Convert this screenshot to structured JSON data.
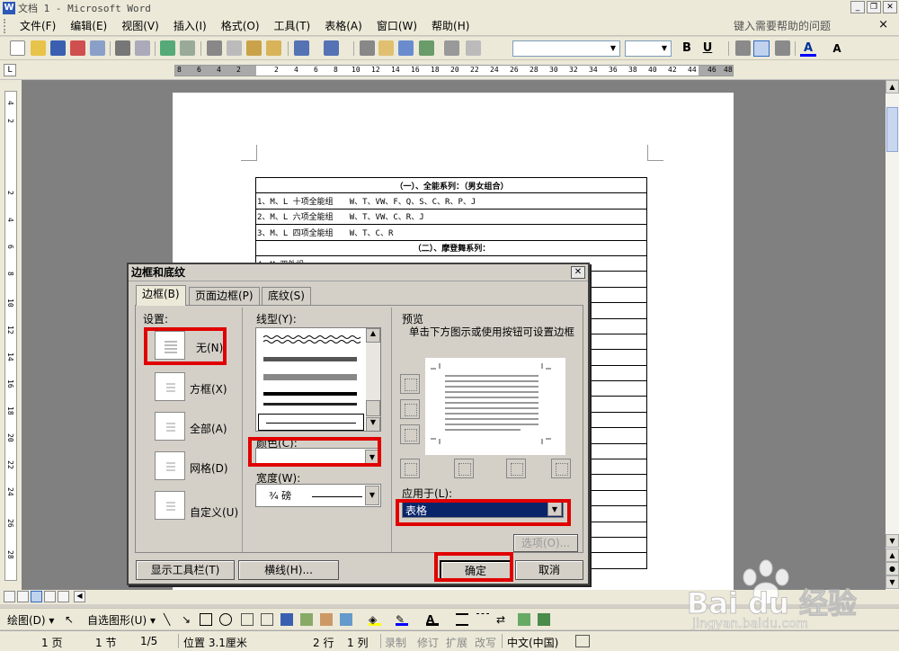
{
  "window": {
    "title": "文档 1 - Microsoft Word",
    "app_icon": "W",
    "buttons": [
      "_",
      "❐",
      "✕"
    ]
  },
  "menu": {
    "items": [
      "文件(F)",
      "编辑(E)",
      "视图(V)",
      "插入(I)",
      "格式(O)",
      "工具(T)",
      "表格(A)",
      "窗口(W)",
      "帮助(H)"
    ],
    "help_placeholder": "键入需要帮助的问题",
    "close": "×"
  },
  "toolbar": {
    "bold": "B",
    "underline": "U",
    "font_color_glyph": "A",
    "grow_font": "A"
  },
  "ruler": {
    "corner": "L",
    "h_ticks": [
      "8",
      "6",
      "4",
      "2",
      "2",
      "4",
      "6",
      "8",
      "10",
      "12",
      "14",
      "16",
      "18",
      "20",
      "22",
      "24",
      "26",
      "28",
      "30",
      "32",
      "34",
      "36",
      "38",
      "40",
      "42",
      "44",
      "46",
      "48"
    ],
    "v_ticks": [
      "4",
      "2",
      "2",
      "4",
      "6",
      "8",
      "10",
      "12",
      "14",
      "16",
      "18",
      "20",
      "22",
      "24",
      "26",
      "28"
    ]
  },
  "document": {
    "rows": [
      {
        "header": true,
        "text": "（一）、全能系列：（男女组合）"
      },
      {
        "header": false,
        "name": "1、M、L 十项全能组",
        "value": "W、T、VW、F、Q、S、C、R、P、J"
      },
      {
        "header": false,
        "name": "2、M、L 六项全能组",
        "value": "W、T、VW、C、R、J"
      },
      {
        "header": false,
        "name": "3、M、L 四项全能组",
        "value": "W、T、C、R"
      },
      {
        "header": true,
        "text": "（二）、摩登舞系列："
      }
    ],
    "hidden_row": "4、M 双外组"
  },
  "dialog": {
    "title": "边框和底纹",
    "tabs": [
      "边框(B)",
      "页面边框(P)",
      "底纹(S)"
    ],
    "setting_label": "设置:",
    "settings": [
      "无(N)",
      "方框(X)",
      "全部(A)",
      "网格(D)",
      "自定义(U)"
    ],
    "style_label": "线型(Y):",
    "color_label": "颜色(C):",
    "color_value": "",
    "width_label": "宽度(W):",
    "width_value": "¾ 磅",
    "preview_label": "预览",
    "preview_hint": "单击下方图示或使用按钮可设置边框",
    "apply_label": "应用于(L):",
    "apply_value": "表格",
    "options_button": "选项(O)...",
    "show_toolbar_button": "显示工具栏(T)",
    "horizontal_line_button": "横线(H)...",
    "ok_button": "确定",
    "cancel_button": "取消"
  },
  "drawbar": {
    "draw": "绘图(D) ▾",
    "autoshapes": "自选图形(U) ▾"
  },
  "status": {
    "page": "1 页",
    "section": "1 节",
    "pages": "1/5",
    "position": "位置 3.1厘米",
    "line": "2 行",
    "column": "1 列",
    "rec": "录制",
    "trk": "修订",
    "ext": "扩展",
    "ovr": "改写",
    "lang": "中文(中国)"
  },
  "watermark": {
    "logo": "Bai du 经验",
    "url": "jingyan.baidu.com"
  },
  "colors": {
    "highlight_red": "#e00000",
    "selection_navy": "#0a246a",
    "workspace_gray": "#808080"
  }
}
